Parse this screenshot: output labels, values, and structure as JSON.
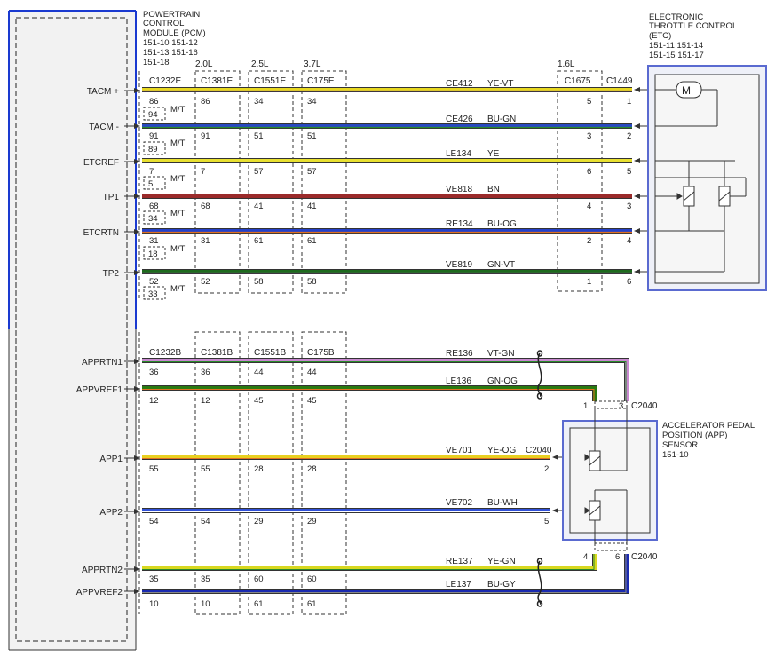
{
  "pcm": {
    "title_lines": [
      "POWERTRAIN",
      "CONTROL",
      "MODULE (PCM)",
      "151-10  151-12",
      "151-13  151-16",
      "151-18"
    ]
  },
  "etc": {
    "title_lines": [
      "ELECTRONIC",
      "THROTTLE CONTROL",
      "(ETC)",
      "151-11  151-14",
      "151-15  151-17"
    ]
  },
  "app_sensor": {
    "title_lines": [
      "ACCELERATOR PEDAL",
      "POSITION (APP)",
      "SENSOR",
      "151-10"
    ]
  },
  "engine_variants": [
    "2.0L",
    "2.5L",
    "3.7L",
    "1.6L"
  ],
  "mt_label": "M/T",
  "connectors_top": [
    "C1232E",
    "C1381E",
    "C1551E",
    "C175E",
    "C1675",
    "C1449"
  ],
  "connectors_bottom": [
    "C1232B",
    "C1381B",
    "C1551B",
    "C175B"
  ],
  "c2040_label": "C2040",
  "top_circuits": [
    {
      "signal": "TACM +",
      "circuit": "CE412",
      "color_code": "YE-VT",
      "pins": [
        "86",
        "86",
        "34",
        "34"
      ],
      "mt_pin": "94",
      "p1675": "5",
      "p1449": "1",
      "color": "#e8d820",
      "stripe": "#8a4aa0"
    },
    {
      "signal": "TACM -",
      "circuit": "CE426",
      "color_code": "BU-GN",
      "pins": [
        "91",
        "91",
        "51",
        "51"
      ],
      "mt_pin": "89",
      "p1675": "3",
      "p1449": "2",
      "color": "#2848c0",
      "stripe": "#2a8a2a"
    },
    {
      "signal": "ETCREF",
      "circuit": "LE134",
      "color_code": "YE",
      "pins": [
        "7",
        "7",
        "57",
        "57"
      ],
      "mt_pin": "5",
      "p1675": "6",
      "p1449": "5",
      "color": "#e8e030",
      "stripe": ""
    },
    {
      "signal": "TP1",
      "circuit": "VE818",
      "color_code": "BN",
      "pins": [
        "68",
        "68",
        "41",
        "41"
      ],
      "mt_pin": "34",
      "p1675": "4",
      "p1449": "3",
      "color": "#9a2a2a",
      "stripe": ""
    },
    {
      "signal": "ETCRTN",
      "circuit": "RE134",
      "color_code": "BU-OG",
      "pins": [
        "31",
        "31",
        "61",
        "61"
      ],
      "mt_pin": "18",
      "p1675": "2",
      "p1449": "4",
      "color": "#2440c8",
      "stripe": "#e07020"
    },
    {
      "signal": "TP2",
      "circuit": "VE819",
      "color_code": "GN-VT",
      "pins": [
        "52",
        "52",
        "58",
        "58"
      ],
      "mt_pin": "33",
      "p1675": "1",
      "p1449": "6",
      "color": "#1e6a1e",
      "stripe": "#8a4aa0"
    }
  ],
  "bottom_circuits": [
    {
      "signal": "APPRTN1",
      "circuit": "RE136",
      "color_code": "VT-GN",
      "pins": [
        "36",
        "36",
        "44",
        "44"
      ],
      "app_pin": "3",
      "color": "#c888d0",
      "stripe": "#2a8a2a"
    },
    {
      "signal": "APPVREF1",
      "circuit": "LE136",
      "color_code": "GN-OG",
      "pins": [
        "12",
        "12",
        "45",
        "45"
      ],
      "app_pin": "1",
      "color": "#2a7a10",
      "stripe": "#e07020"
    },
    {
      "signal": "APP1",
      "circuit": "VE701",
      "color_code": "YE-OG",
      "pins": [
        "55",
        "55",
        "28",
        "28"
      ],
      "app_pin": "2",
      "color": "#e8d020",
      "stripe": "#e07020"
    },
    {
      "signal": "APP2",
      "circuit": "VE702",
      "color_code": "BU-WH",
      "pins": [
        "54",
        "54",
        "29",
        "29"
      ],
      "app_pin": "5",
      "color": "#3050d8",
      "stripe": "#ffffff"
    },
    {
      "signal": "APPRTN2",
      "circuit": "RE137",
      "color_code": "YE-GN",
      "pins": [
        "35",
        "35",
        "60",
        "60"
      ],
      "app_pin": "4",
      "color": "#d8d820",
      "stripe": "#2a8a2a"
    },
    {
      "signal": "APPVREF2",
      "circuit": "LE137",
      "color_code": "BU-GY",
      "pins": [
        "10",
        "10",
        "61",
        "61"
      ],
      "app_pin": "6",
      "color": "#1a2ab0",
      "stripe": "#888888"
    }
  ]
}
